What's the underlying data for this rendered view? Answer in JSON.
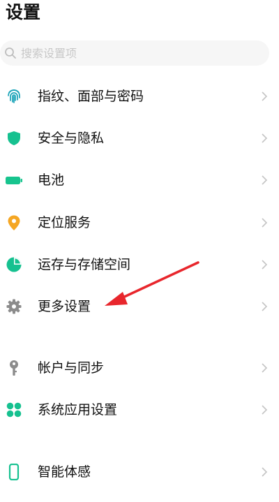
{
  "header": {
    "title": "设置"
  },
  "search": {
    "placeholder": "搜索设置项",
    "icon": "search-icon"
  },
  "items": [
    {
      "label": "指纹、面部与密码",
      "icon": "fingerprint-icon",
      "color": "#1aa3b8"
    },
    {
      "label": "安全与隐私",
      "icon": "shield-icon",
      "color": "#16c190"
    },
    {
      "label": "电池",
      "icon": "battery-icon",
      "color": "#17c48e"
    },
    {
      "label": "定位服务",
      "icon": "location-pin-icon",
      "color": "#f5a623"
    },
    {
      "label": "运存与存储空间",
      "icon": "pie-chart-icon",
      "color": "#16c190"
    },
    {
      "label": "更多设置",
      "icon": "gear-icon",
      "color": "#8c8c8c"
    },
    {
      "label": "帐户与同步",
      "icon": "key-icon",
      "color": "#8c8c8c"
    },
    {
      "label": "系统应用设置",
      "icon": "apps-grid-icon",
      "color": "#16c190"
    },
    {
      "label": "智能体感",
      "icon": "phone-icon",
      "color": "#16c190"
    }
  ],
  "annotation": {
    "icon": "red-arrow-annotation",
    "color": "#e8262c"
  }
}
